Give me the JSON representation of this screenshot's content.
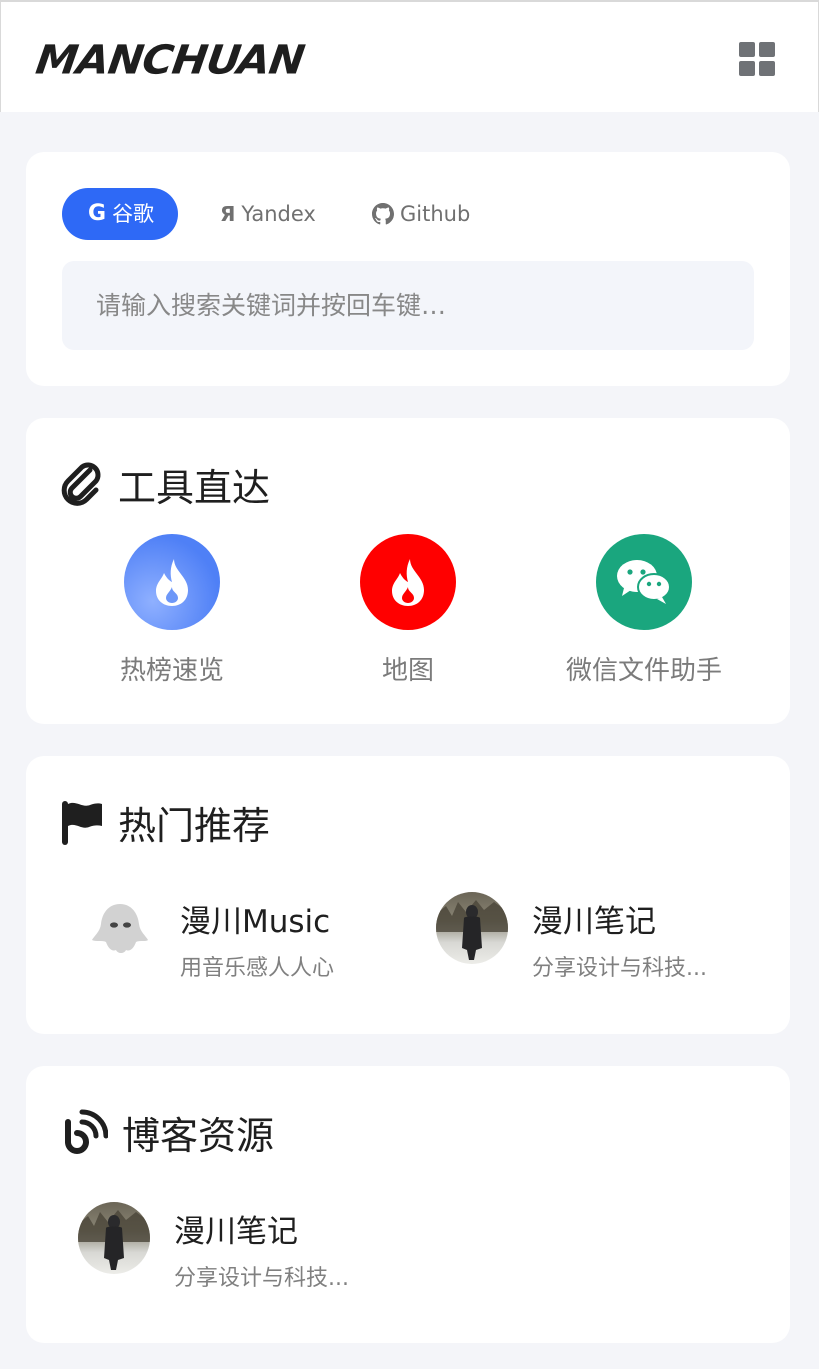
{
  "header": {
    "logo_text": "MANCHUAN",
    "menu_icon": "grid-icon"
  },
  "search": {
    "engines": [
      {
        "label": "谷歌",
        "icon": "google-icon",
        "active": true
      },
      {
        "label": "Yandex",
        "icon": "yandex-icon",
        "active": false
      },
      {
        "label": "Github",
        "icon": "github-icon",
        "active": false
      }
    ],
    "placeholder": "请输入搜索关键词并按回车键…",
    "accent": "#2e69f6"
  },
  "tools": {
    "title": "工具直达",
    "icon": "paperclip-icon",
    "items": [
      {
        "label": "热榜速览",
        "icon": "flame-icon",
        "color": "#4f80f6"
      },
      {
        "label": "地图",
        "icon": "flame-icon",
        "color": "#ff0000"
      },
      {
        "label": "微信文件助手",
        "icon": "wechat-icon",
        "color": "#1aa67e"
      }
    ]
  },
  "hot": {
    "title": "热门推荐",
    "icon": "flag-icon",
    "items": [
      {
        "title": "漫川Music",
        "desc": "用音乐感人人心",
        "avatar": "ghost-icon"
      },
      {
        "title": "漫川笔记",
        "desc": "分享设计与科技...",
        "avatar": "person-photo"
      }
    ]
  },
  "blog": {
    "title": "博客资源",
    "icon": "rss-icon",
    "items": [
      {
        "title": "漫川笔记",
        "desc": "分享设计与科技...",
        "avatar": "person-photo"
      }
    ]
  }
}
